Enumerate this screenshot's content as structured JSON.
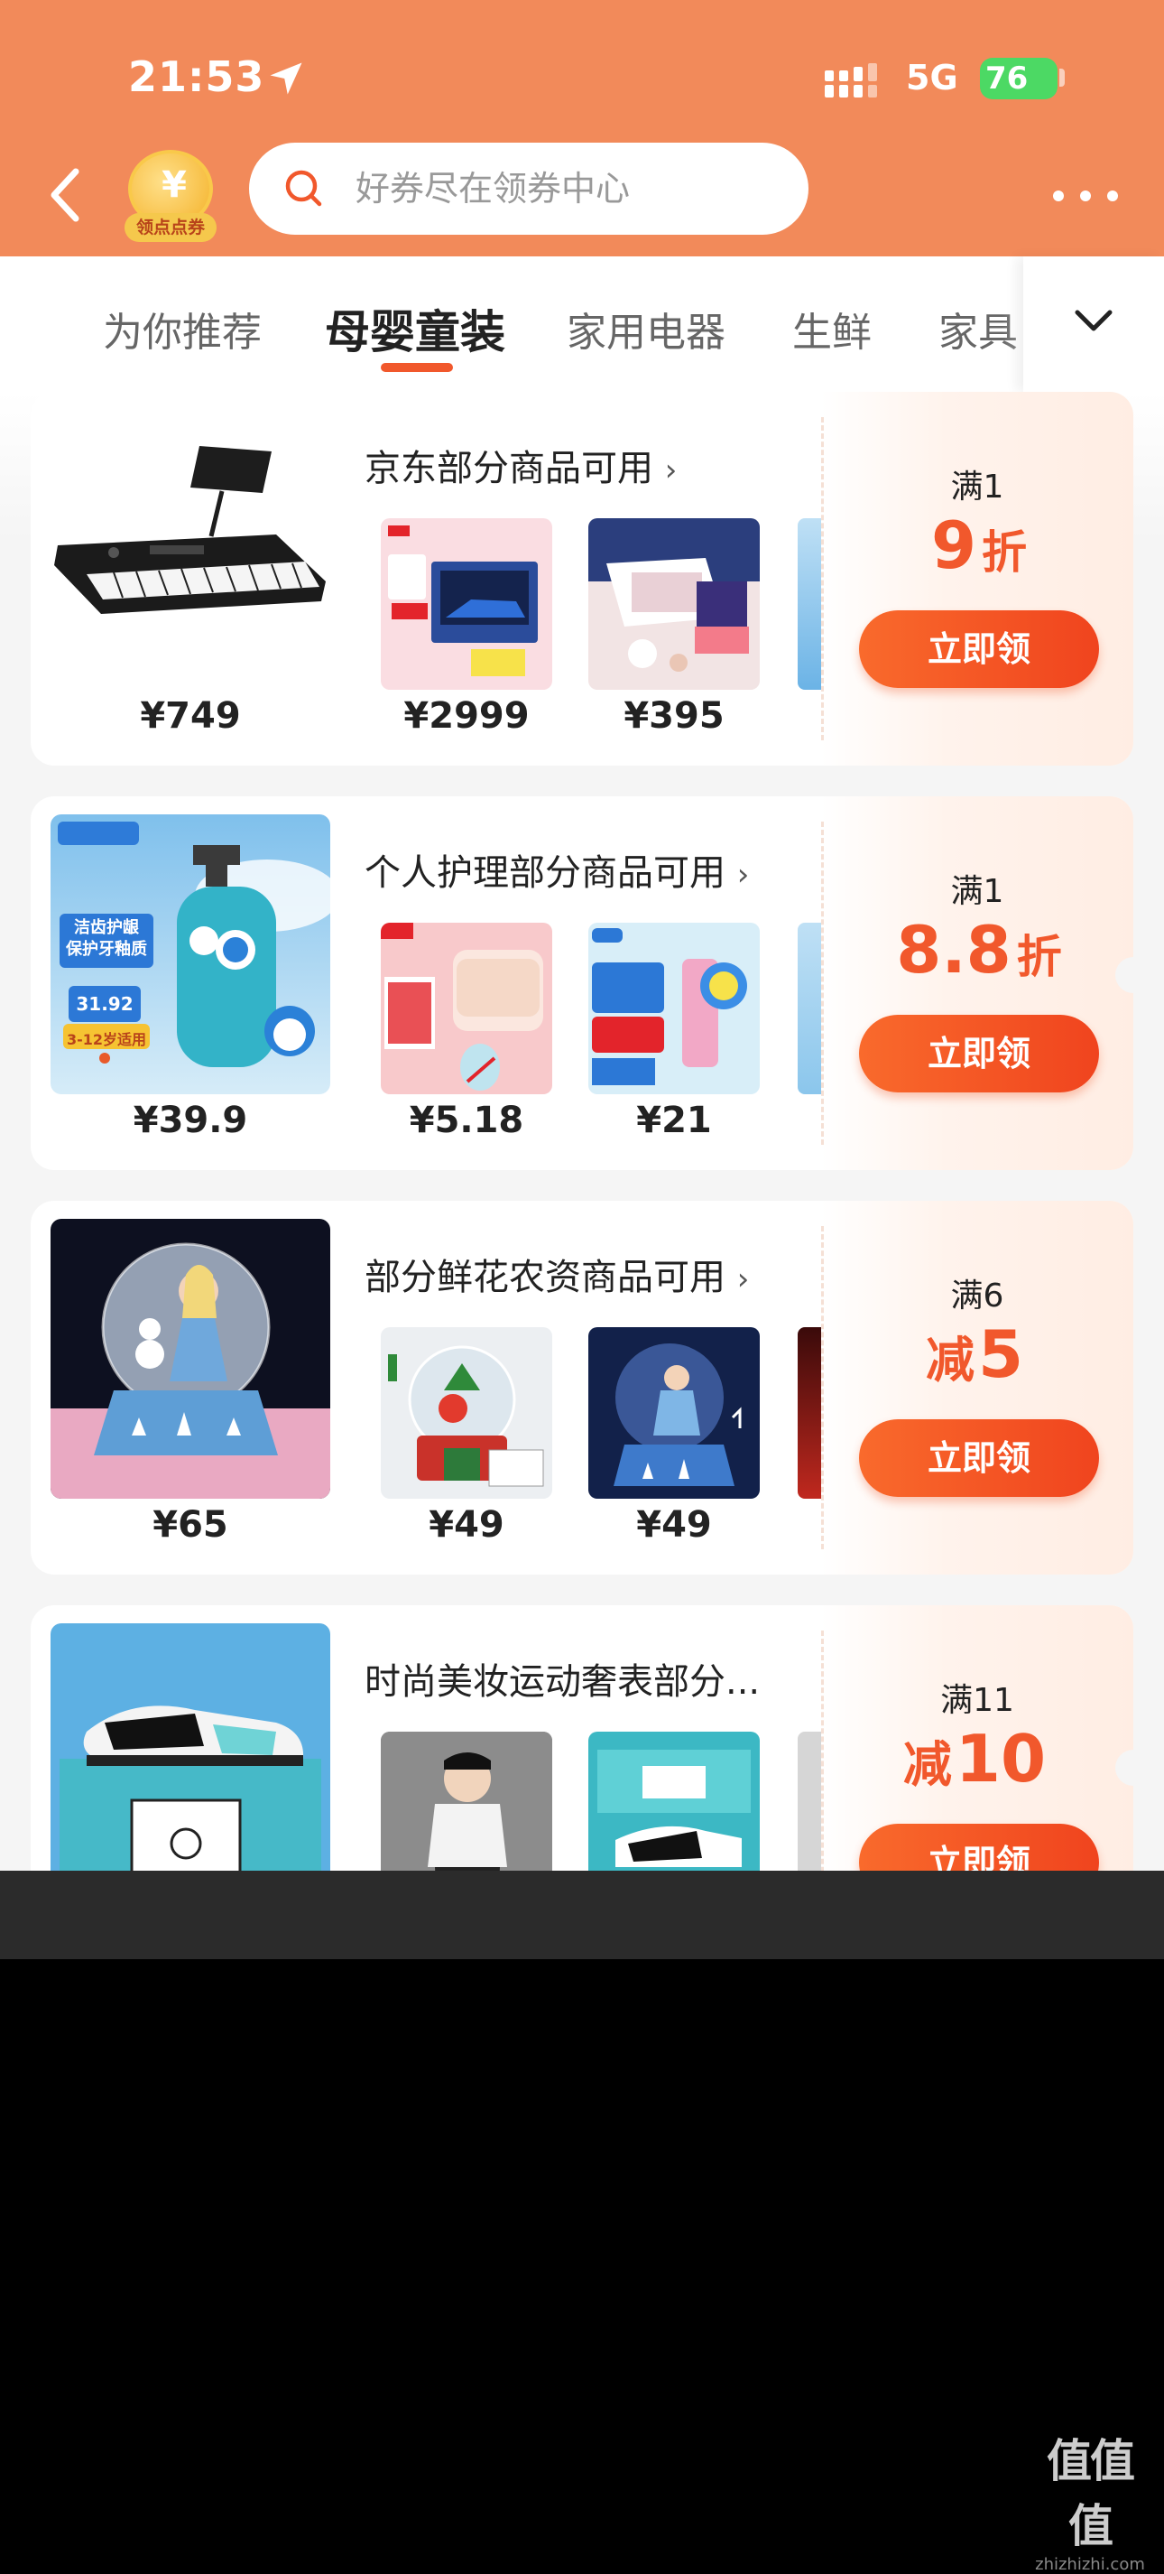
{
  "status_bar": {
    "time": "21:53",
    "network": "5G",
    "battery": "76"
  },
  "header": {
    "coin_label": "领点点券",
    "coin_symbol": "¥",
    "search_placeholder": "好券尽在领券中心"
  },
  "tabs": [
    "为你推荐",
    "母婴童装",
    "家用电器",
    "生鲜",
    "家具"
  ],
  "active_tab_index": 1,
  "cards": [
    {
      "title": "京东部分商品可用",
      "chevron": "›",
      "main_price": "¥749",
      "thumbs": [
        {
          "price": "¥2999"
        },
        {
          "price": "¥395"
        }
      ],
      "threshold": "满1",
      "discount_prefix": "",
      "discount_value": "9",
      "discount_unit": "折",
      "button": "立即领"
    },
    {
      "title": "个人护理部分商品可用",
      "chevron": "›",
      "main_price": "¥39.9",
      "thumbs": [
        {
          "price": "¥5.18"
        },
        {
          "price": "¥21"
        }
      ],
      "threshold": "满1",
      "discount_prefix": "",
      "discount_value": "8.8",
      "discount_unit": "折",
      "button": "立即领",
      "main_img_text": {
        "brand": "洁齿护龈",
        "line2": "保护牙釉质",
        "price_tag": "31.92",
        "age": "3-12岁适用"
      }
    },
    {
      "title": "部分鲜花农资商品可用",
      "chevron": "›",
      "main_price": "¥65",
      "thumbs": [
        {
          "price": "¥49"
        },
        {
          "price": "¥49"
        }
      ],
      "threshold": "满6",
      "discount_prefix": "减",
      "discount_value": "5",
      "discount_unit": "",
      "button": "立即领"
    },
    {
      "title": "时尚美妆运动奢表部分...",
      "chevron": "",
      "main_price": "",
      "thumbs": [
        {
          "price": ""
        },
        {
          "price": ""
        }
      ],
      "threshold": "满11",
      "discount_prefix": "减",
      "discount_value": "10",
      "discount_unit": "",
      "button": "立即领"
    }
  ],
  "watermark": {
    "logo": "值值值",
    "url": "zhizhizhi.com"
  },
  "colors": {
    "header_bg": "#F28A5A",
    "accent": "#F1582C",
    "button_start": "#F96A2C",
    "button_end": "#F0441E"
  }
}
